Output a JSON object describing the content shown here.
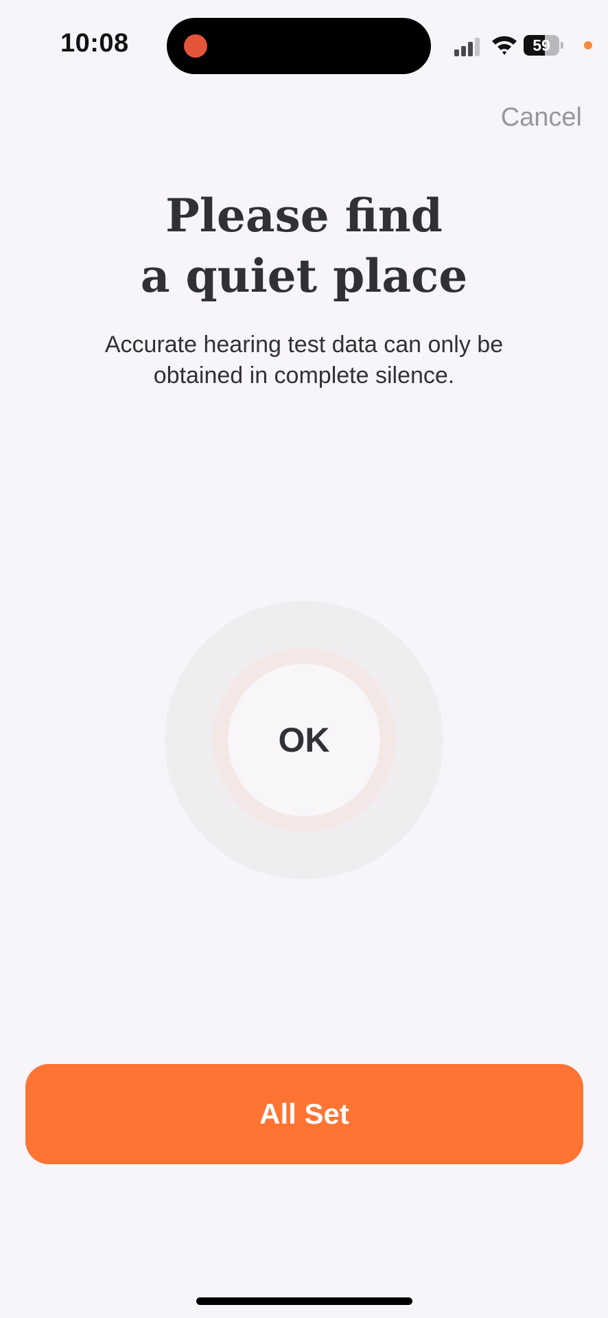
{
  "status_bar": {
    "time": "10:08",
    "battery_percent": "59",
    "battery_level": 0.59,
    "recording_indicator_color": "#e4553a",
    "privacy_indicator_color": "#f58a3c",
    "icons": [
      "cellular-signal-icon",
      "wifi-icon",
      "battery-icon"
    ]
  },
  "header": {
    "cancel_label": "Cancel"
  },
  "main": {
    "title_line_1": "Please find",
    "title_line_2": "a quiet place",
    "subtitle_line_1": "Accurate hearing test data can only be",
    "subtitle_line_2": "obtained in complete silence.",
    "noise_indicator": {
      "status_label": "OK"
    }
  },
  "footer": {
    "primary_button_label": "All Set",
    "accent_color": "#ff7333"
  }
}
